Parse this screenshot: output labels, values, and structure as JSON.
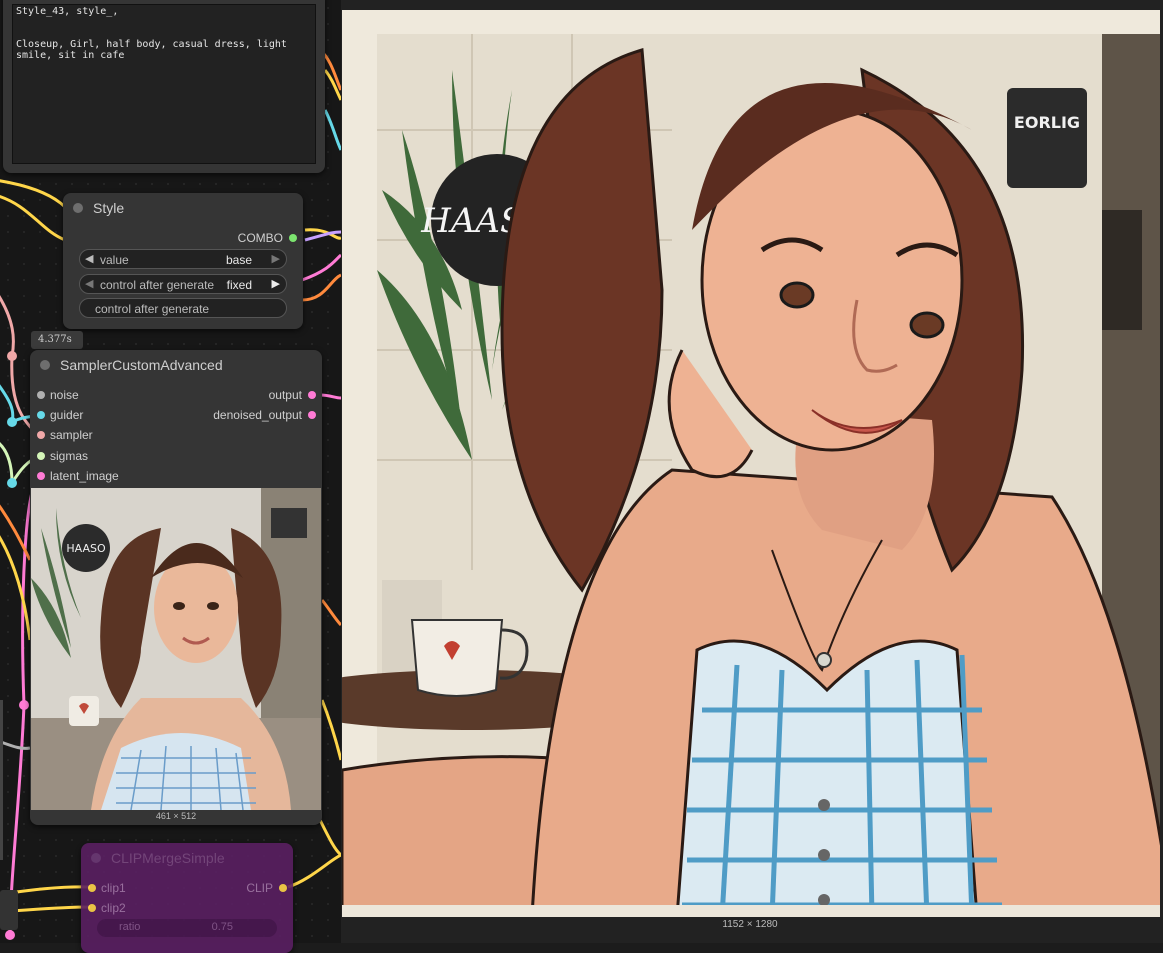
{
  "text_node": {
    "content": "Style_43, style_,\n\n\nCloseup, Girl, half body, casual dress, light\nsmile, sit in cafe"
  },
  "style_node": {
    "title": "Style",
    "output_label": "COMBO",
    "widgets": [
      {
        "label": "value",
        "value": "base"
      },
      {
        "label": "control after generate",
        "value": "fixed"
      }
    ],
    "button_label": "control after generate"
  },
  "execution_time": "4.377s",
  "sampler_node": {
    "title": "SamplerCustomAdvanced",
    "inputs": [
      "noise",
      "guider",
      "sampler",
      "sigmas",
      "latent_image"
    ],
    "outputs": [
      "output",
      "denoised_output"
    ],
    "preview_size": "461 × 512"
  },
  "clip_node": {
    "title": "CLIPMergeSimple",
    "inputs": [
      "clip1",
      "clip2"
    ],
    "output": "CLIP",
    "ratio_label": "ratio",
    "ratio_value": "0.75"
  },
  "main_preview": {
    "size": "1152 × 1280"
  },
  "image_signs": {
    "wall_sign": "HAASO3",
    "board_sign": "EORLIG"
  },
  "colors": {
    "node_bg": "#353535",
    "canvas_bg": "#171717",
    "slot_noise": "#b0b0b0",
    "slot_guider": "#66d9e8",
    "slot_sampler": "#f0a8a8",
    "slot_sigmas": "#d4f5b8",
    "slot_latent": "#ff7bd5",
    "output_pink": "#ff7bd5",
    "combo_green": "#7ce46f",
    "clip_purple": "#5a1f62",
    "clip_yellow": "#ffd64a"
  }
}
